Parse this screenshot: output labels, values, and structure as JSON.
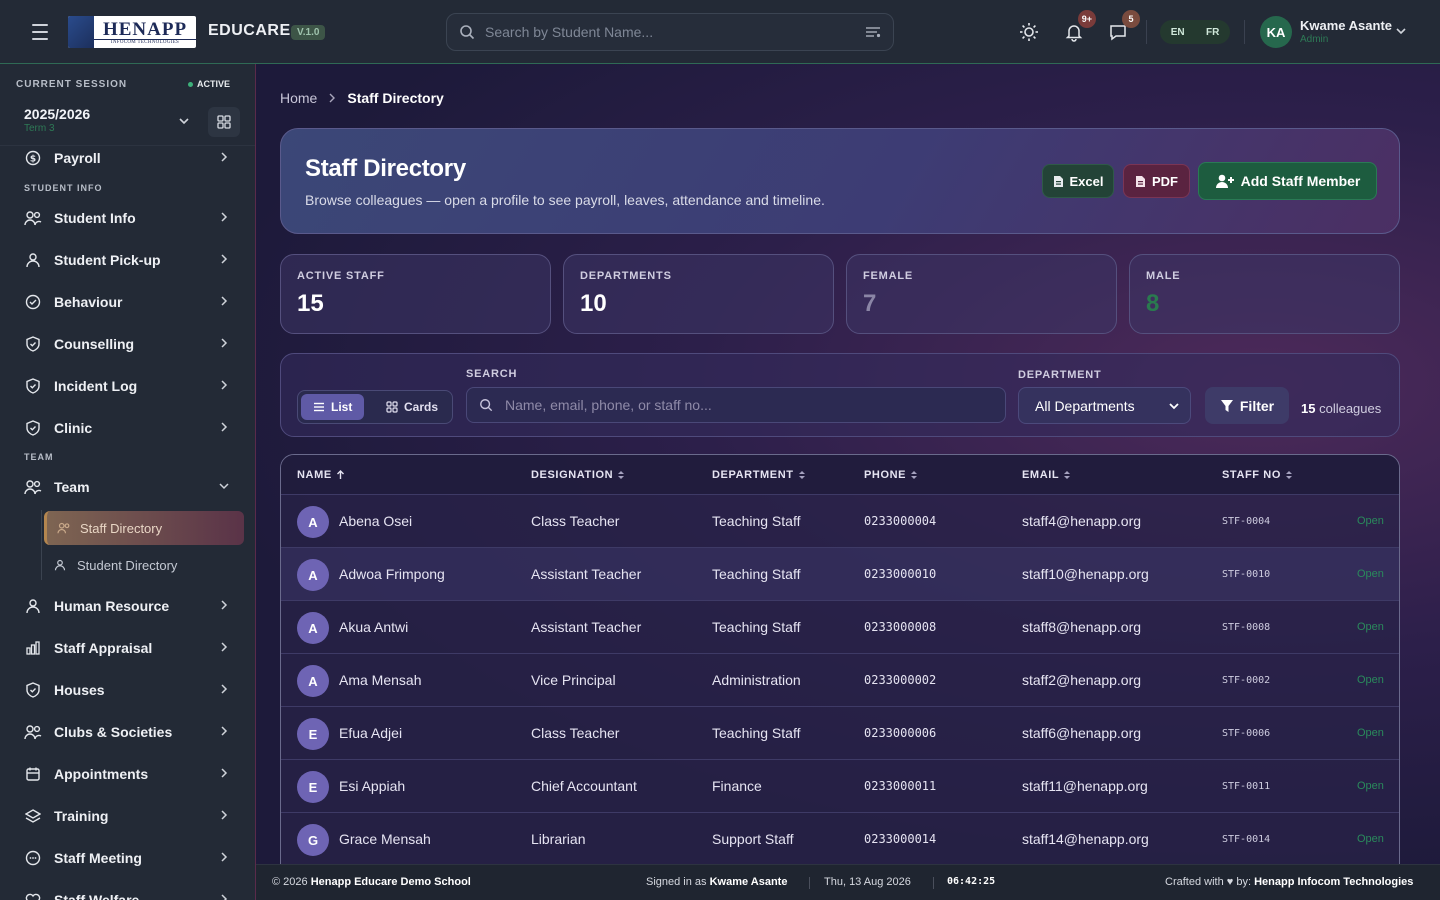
{
  "topbar": {
    "logo_main": "HENAPP",
    "logo_sub": "INFOCOM TECHNOLOGIES",
    "brand": "EDUCARE",
    "version": "V.1.0",
    "search_placeholder": "Search by Student Name...",
    "notifications_badge": "9+",
    "messages_badge": "5",
    "lang_en": "EN",
    "lang_fr": "FR",
    "avatar_initials": "KA",
    "user_name": "Kwame Asante",
    "user_role": "Admin"
  },
  "session": {
    "label": "CURRENT SESSION",
    "status": "ACTIVE",
    "year": "2025/2026",
    "term": "Term 3"
  },
  "sidebar": {
    "partial_item": "Payroll",
    "section_student": "STUDENT INFO",
    "section_team": "TEAM",
    "student_items": [
      "Student Info",
      "Student Pick-up",
      "Behaviour",
      "Counselling",
      "Incident Log",
      "Clinic"
    ],
    "team": "Team",
    "sub_items": [
      "Staff Directory",
      "Student Directory"
    ],
    "after_items": [
      "Human Resource",
      "Staff Appraisal",
      "Houses",
      "Clubs & Societies",
      "Appointments",
      "Training",
      "Staff Meeting",
      "Staff Welfare"
    ]
  },
  "breadcrumb": {
    "home": "Home",
    "current": "Staff Directory"
  },
  "hero": {
    "title": "Staff Directory",
    "subtitle": "Browse colleagues — open a profile to see payroll, leaves, attendance and timeline.",
    "excel": "Excel",
    "pdf": "PDF",
    "add": "Add Staff Member"
  },
  "stats": [
    {
      "label": "ACTIVE STAFF",
      "value": "15",
      "color": "#ffffff"
    },
    {
      "label": "DEPARTMENTS",
      "value": "10",
      "color": "#ffffff"
    },
    {
      "label": "FEMALE",
      "value": "7",
      "color": "#8b86a6"
    },
    {
      "label": "MALE",
      "value": "8",
      "color": "#2a7a4f"
    }
  ],
  "filters": {
    "view_list": "List",
    "view_cards": "Cards",
    "search_label": "SEARCH",
    "search_placeholder": "Name, email, phone, or staff no...",
    "department_label": "DEPARTMENT",
    "department_value": "All Departments",
    "filter_button": "Filter",
    "count": "15",
    "count_suffix": "colleagues"
  },
  "table": {
    "headers": [
      "NAME",
      "DESIGNATION",
      "DEPARTMENT",
      "PHONE",
      "EMAIL",
      "STAFF NO"
    ],
    "action_label": "Open",
    "rows": [
      {
        "initial": "A",
        "name": "Abena Osei",
        "designation": "Class Teacher",
        "department": "Teaching Staff",
        "phone": "0233000004",
        "email": "staff4@henapp.org",
        "staff_no": "STF-0004"
      },
      {
        "initial": "A",
        "name": "Adwoa Frimpong",
        "designation": "Assistant Teacher",
        "department": "Teaching Staff",
        "phone": "0233000010",
        "email": "staff10@henapp.org",
        "staff_no": "STF-0010"
      },
      {
        "initial": "A",
        "name": "Akua Antwi",
        "designation": "Assistant Teacher",
        "department": "Teaching Staff",
        "phone": "0233000008",
        "email": "staff8@henapp.org",
        "staff_no": "STF-0008"
      },
      {
        "initial": "A",
        "name": "Ama Mensah",
        "designation": "Vice Principal",
        "department": "Administration",
        "phone": "0233000002",
        "email": "staff2@henapp.org",
        "staff_no": "STF-0002"
      },
      {
        "initial": "E",
        "name": "Efua Adjei",
        "designation": "Class Teacher",
        "department": "Teaching Staff",
        "phone": "0233000006",
        "email": "staff6@henapp.org",
        "staff_no": "STF-0006"
      },
      {
        "initial": "E",
        "name": "Esi Appiah",
        "designation": "Chief Accountant",
        "department": "Finance",
        "phone": "0233000011",
        "email": "staff11@henapp.org",
        "staff_no": "STF-0011"
      },
      {
        "initial": "G",
        "name": "Grace Mensah",
        "designation": "Librarian",
        "department": "Support Staff",
        "phone": "0233000014",
        "email": "staff14@henapp.org",
        "staff_no": "STF-0014"
      }
    ]
  },
  "footer": {
    "copyright_prefix": "© 2026",
    "school": "Henapp Educare Demo School",
    "signed_prefix": "Signed in as",
    "signed_user": "Kwame Asante",
    "date": "Thu, 13 Aug 2026",
    "time": "06:42:25",
    "crafted_prefix": "Crafted with ♥ by:",
    "crafted_by": "Henapp Infocom Technologies"
  }
}
